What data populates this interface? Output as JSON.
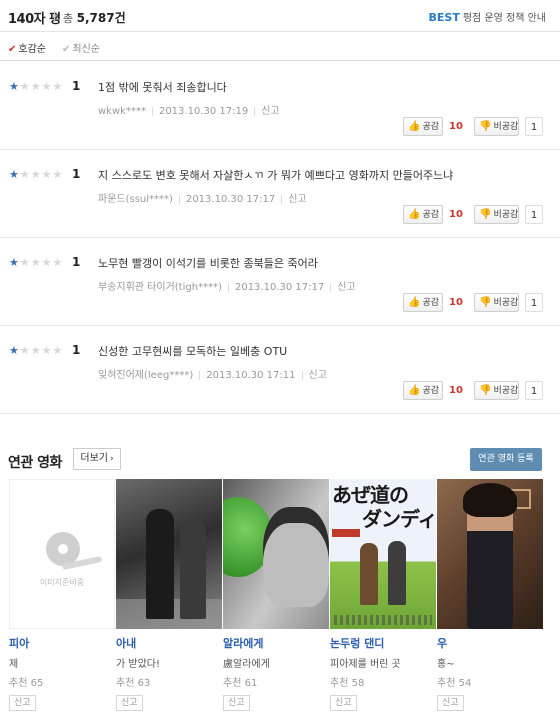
{
  "header": {
    "title": "140자 평",
    "count_prefix": "총",
    "count": "5,787건",
    "best_label": "BEST",
    "policy_text": "평점 운영 정책 안내"
  },
  "sort": {
    "options": [
      "호감순",
      "최신순"
    ],
    "active": "호감순"
  },
  "reviews": [
    {
      "stars": 1,
      "score": "1",
      "text": "1점 밖에 못줘서 죄송합니다",
      "user": "wkwk****",
      "date": "2013.10.30 17:19",
      "report": "신고",
      "like_label": "공감",
      "like_count": "10",
      "dislike_label": "비공감",
      "dislike_count": "1"
    },
    {
      "stars": 1,
      "score": "1",
      "text": "지 스스로도 변호 못해서 자살한ㅅㄲ 가 뭐가 예쁘다고 영화까지 만들어주느냐",
      "user": "파운드(ssul****)",
      "date": "2013.10.30 17:17",
      "report": "신고",
      "like_label": "공감",
      "like_count": "10",
      "dislike_label": "비공감",
      "dislike_count": "1"
    },
    {
      "stars": 1,
      "score": "1",
      "text": "노무현 빨갱이 이석기를 비롯한 종북들은 죽어라",
      "user": "부송지휘관 타이거(tigh****)",
      "date": "2013.10.30 17:17",
      "report": "신고",
      "like_label": "공감",
      "like_count": "10",
      "dislike_label": "비공감",
      "dislike_count": "1"
    },
    {
      "stars": 1,
      "score": "1",
      "text": "신성한 고무현씨를 모독하는 일베충 OTU",
      "user": "잊혀진어제(leeg****)",
      "date": "2013.10.30 17:11",
      "report": "신고",
      "like_label": "공감",
      "like_count": "10",
      "dislike_label": "비공감",
      "dislike_count": "1"
    }
  ],
  "related": {
    "title": "연관 영화",
    "more_label": "더보기",
    "register_label": "연관 영화 등록",
    "placeholder_text": "이미지준비중",
    "movies": [
      {
        "title": "피아",
        "subtitle": "제",
        "recommend": "추천 65",
        "report": "신고",
        "poster": "empty"
      },
      {
        "title": "아내",
        "subtitle": "가 받았다!",
        "recommend": "추천 63",
        "report": "신고",
        "poster": "p2"
      },
      {
        "title": "알라에게",
        "subtitle": "盧알라에게",
        "recommend": "추천 61",
        "report": "신고",
        "poster": "p3"
      },
      {
        "title": "논두렁 댄디",
        "subtitle": "피아제를 버린 곳",
        "recommend": "추천 58",
        "report": "신고",
        "poster": "p4",
        "poster_text_1": "あぜ道の",
        "poster_text_2": "ダンディ"
      },
      {
        "title": "우",
        "subtitle": "홍~",
        "recommend": "추천 54",
        "report": "신고",
        "poster": "p5"
      }
    ]
  }
}
